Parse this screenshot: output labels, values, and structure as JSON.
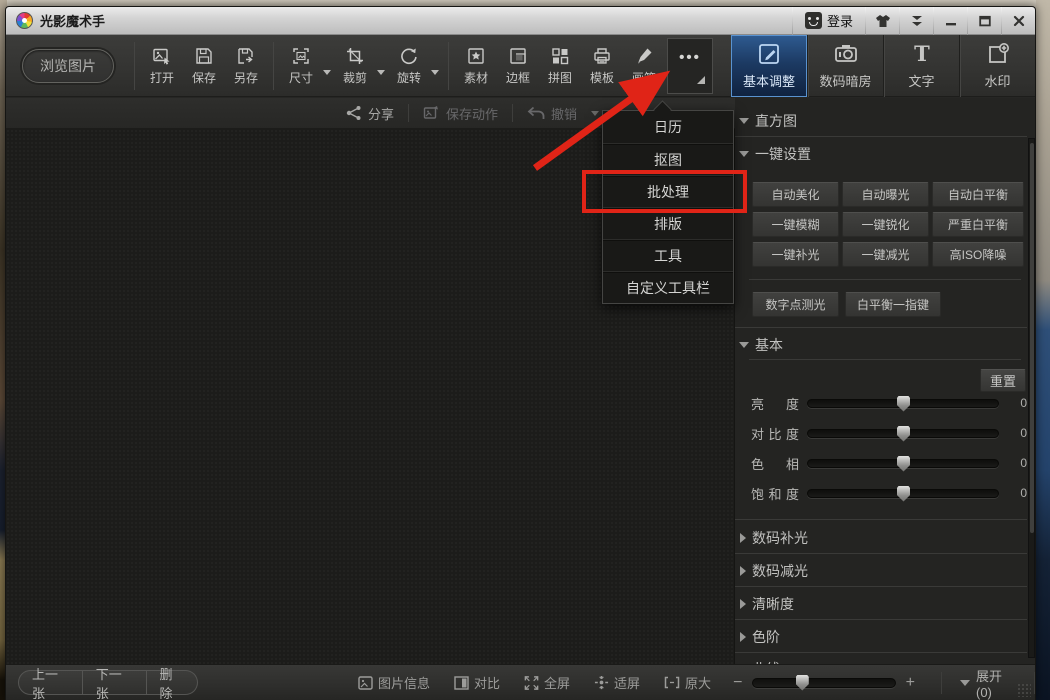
{
  "titlebar": {
    "app_title": "光影魔术手",
    "login_label": "登录"
  },
  "toolbar": {
    "browse_label": "浏览图片",
    "buttons": [
      {
        "label": "打开"
      },
      {
        "label": "保存"
      },
      {
        "label": "另存"
      },
      {
        "label": "尺寸"
      },
      {
        "label": "裁剪"
      },
      {
        "label": "旋转"
      },
      {
        "label": "素材"
      },
      {
        "label": "边框"
      },
      {
        "label": "拼图"
      },
      {
        "label": "模板"
      },
      {
        "label": "画笔"
      }
    ],
    "more_label": "•••",
    "tabs": [
      {
        "label": "基本调整",
        "selected": true
      },
      {
        "label": "数码暗房",
        "selected": false
      },
      {
        "label": "文字",
        "selected": false
      },
      {
        "label": "水印",
        "selected": false
      }
    ]
  },
  "actionbar": {
    "share": "分享",
    "save_action": "保存动作",
    "undo": "撤销"
  },
  "dropdown_menu": {
    "items": [
      "日历",
      "抠图",
      "批处理",
      "排版",
      "工具",
      "自定义工具栏"
    ],
    "annotated_item": "批处理"
  },
  "panel": {
    "histogram_title": "直方图",
    "oneclick_title": "一键设置",
    "grid_buttons": [
      "自动美化",
      "自动曝光",
      "自动白平衡",
      "一键模糊",
      "一键锐化",
      "严重白平衡",
      "一键补光",
      "一键减光",
      "高ISO降噪"
    ],
    "extra_buttons": [
      "数字点测光",
      "白平衡一指键"
    ],
    "basic": {
      "title": "基本",
      "reset_label": "重置",
      "sliders": [
        {
          "label": "亮度",
          "value": "0"
        },
        {
          "label": "对比度",
          "value": "0"
        },
        {
          "label": "色相",
          "value": "0"
        },
        {
          "label": "饱和度",
          "value": "0"
        }
      ]
    },
    "collapsed_sections": [
      "数码补光",
      "数码减光",
      "清晰度",
      "色阶",
      "曲线"
    ]
  },
  "statusbar": {
    "prev": "上一张",
    "next": "下一张",
    "delete": "删除",
    "view_items": [
      "图片信息",
      "对比",
      "全屏",
      "适屏",
      "原大"
    ],
    "zoom_minus": "−",
    "zoom_plus": "+",
    "expand": "展开(0)"
  },
  "colors": {
    "selected_tab_blue": "#1c3a63",
    "selected_tab_border": "#5a93d0",
    "annotation_red": "#e02417",
    "titlebar_gray": "#d4d4d4",
    "panel_bg": "#242422"
  }
}
